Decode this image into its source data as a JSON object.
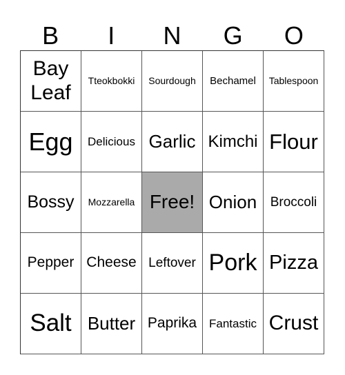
{
  "header": [
    "B",
    "I",
    "N",
    "G",
    "O"
  ],
  "free_color": "#aaaaaa",
  "cells": [
    {
      "text": "Bay Leaf",
      "size": 30
    },
    {
      "text": "Tteokbokki",
      "size": 14
    },
    {
      "text": "Sourdough",
      "size": 14
    },
    {
      "text": "Bechamel",
      "size": 15
    },
    {
      "text": "Tablespoon",
      "size": 14
    },
    {
      "text": "Egg",
      "size": 36
    },
    {
      "text": "Delicious",
      "size": 17
    },
    {
      "text": "Garlic",
      "size": 26
    },
    {
      "text": "Kimchi",
      "size": 24
    },
    {
      "text": "Flour",
      "size": 31
    },
    {
      "text": "Bossy",
      "size": 25
    },
    {
      "text": "Mozzarella",
      "size": 14
    },
    {
      "text": "Free!",
      "size": 28,
      "free": true
    },
    {
      "text": "Onion",
      "size": 26
    },
    {
      "text": "Broccoli",
      "size": 19
    },
    {
      "text": "Pepper",
      "size": 21
    },
    {
      "text": "Cheese",
      "size": 21
    },
    {
      "text": "Leftover",
      "size": 19
    },
    {
      "text": "Pork",
      "size": 34
    },
    {
      "text": "Pizza",
      "size": 29
    },
    {
      "text": "Salt",
      "size": 35
    },
    {
      "text": "Butter",
      "size": 26
    },
    {
      "text": "Paprika",
      "size": 21
    },
    {
      "text": "Fantastic",
      "size": 17
    },
    {
      "text": "Crust",
      "size": 30
    }
  ]
}
